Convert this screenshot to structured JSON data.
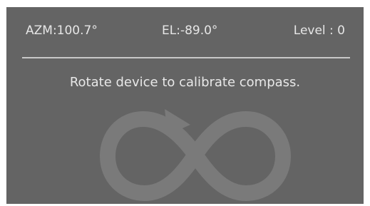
{
  "status": {
    "azimuth": "AZM:100.7°",
    "elevation": "EL:-89.0°",
    "level": "Level : 0"
  },
  "message": "Rotate device to calibrate compass.",
  "icon": {
    "name": "figure-eight-calibration-icon",
    "color": "#7a7a7a"
  },
  "colors": {
    "background": "#646464",
    "text": "#e6e6e6",
    "divider": "#c8c8c8"
  }
}
